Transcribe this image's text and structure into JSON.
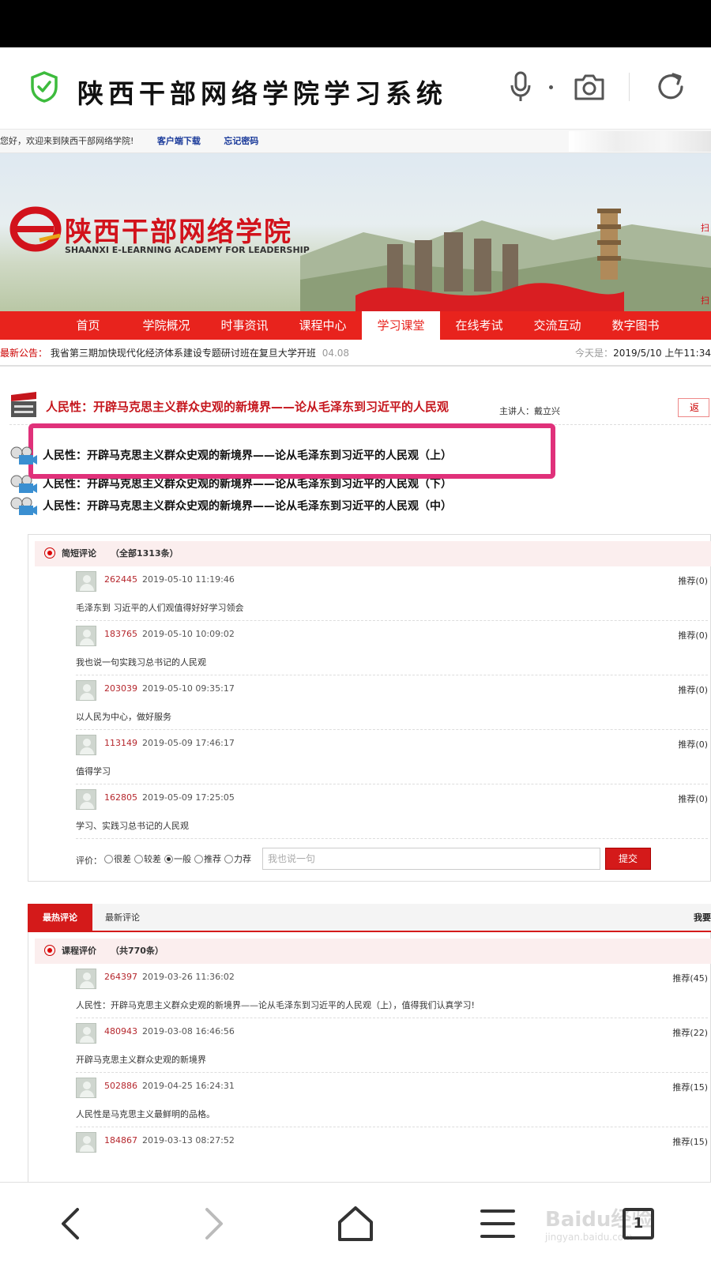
{
  "browser": {
    "title": "陕西干部网络学院学习系统",
    "icons": [
      "shield-check-icon",
      "microphone-icon",
      "camera-icon",
      "reload-icon"
    ]
  },
  "site": {
    "top_strip": {
      "greeting": "您好，欢迎来到陕西干部网络学院!",
      "links": [
        "客户端下载",
        "忘记密码"
      ]
    },
    "banner": {
      "name_cn": "陕西干部网络学院",
      "name_en": "SHAANXI E-LEARNING ACADEMY FOR LEADERSHIP",
      "side_text_1": "扫",
      "side_text_2": "扫"
    },
    "nav": [
      "首页",
      "学院概况",
      "时事资讯",
      "课程中心",
      "学习课堂",
      "在线考试",
      "交流互动",
      "数字图书"
    ],
    "nav_active": "学习课堂",
    "notice": {
      "label": "最新公告：",
      "text": "我省第三期加快现代化经济体系建设专题研讨班在复旦大学开班",
      "date": "04.08",
      "today_label": "今天是：",
      "today": "2019/5/10 上午11:34"
    }
  },
  "course": {
    "title": "人民性：开辟马克思主义群众史观的新境界——论从毛泽东到习近平的人民观",
    "lecturer_label": "主讲人：",
    "lecturer": "戴立兴",
    "back": "返",
    "lessons": [
      "人民性：开辟马克思主义群众史观的新境界——论从毛泽东到习近平的人民观（上）",
      "人民性：开辟马克思主义群众史观的新境界——论从毛泽东到习近平的人民观（下）",
      "人民性：开辟马克思主义群众史观的新境界——论从毛泽东到习近平的人民观（中）"
    ]
  },
  "short_comments": {
    "heading": "简短评论",
    "count": "（全部1313条）",
    "items": [
      {
        "uid": "262445",
        "time": "2019-05-10 11:19:46",
        "rec": "推荐(0)",
        "text": "毛泽东到 习近平的人们观值得好好学习领会"
      },
      {
        "uid": "183765",
        "time": "2019-05-10 10:09:02",
        "rec": "推荐(0)",
        "text": "我也说一句实践习总书记的人民观"
      },
      {
        "uid": "203039",
        "time": "2019-05-10 09:35:17",
        "rec": "推荐(0)",
        "text": "以人民为中心，做好服务"
      },
      {
        "uid": "113149",
        "time": "2019-05-09 17:46:17",
        "rec": "推荐(0)",
        "text": "值得学习"
      },
      {
        "uid": "162805",
        "time": "2019-05-09 17:25:05",
        "rec": "推荐(0)",
        "text": "学习、实践习总书记的人民观"
      }
    ],
    "rating": {
      "label": "评价：",
      "options": [
        "很差",
        "较差",
        "一般",
        "推荐",
        "力荐"
      ],
      "selected": "一般",
      "placeholder": "我也说一句",
      "submit": "提交"
    }
  },
  "tabs": {
    "hot": "最热评论",
    "latest": "最新评论",
    "right": "我要"
  },
  "course_reviews": {
    "heading": "课程评价",
    "count": "（共770条）",
    "items": [
      {
        "uid": "264397",
        "time": "2019-03-26 11:36:02",
        "rec": "推荐(45)",
        "text": "人民性：开辟马克思主义群众史观的新境界——论从毛泽东到习近平的人民观（上），值得我们认真学习!"
      },
      {
        "uid": "480943",
        "time": "2019-03-08 16:46:56",
        "rec": "推荐(22)",
        "text": "开辟马克思主义群众史观的新境界"
      },
      {
        "uid": "502886",
        "time": "2019-04-25 16:24:31",
        "rec": "推荐(15)",
        "text": "人民性是马克思主义最鲜明的品格。"
      },
      {
        "uid": "184867",
        "time": "2019-03-13 08:27:52",
        "rec": "推荐(15)",
        "text": ""
      }
    ]
  },
  "bottom_bar": {
    "icons": [
      "back-icon",
      "forward-icon",
      "home-icon",
      "menu-icon",
      "tabs-icon"
    ],
    "tab_count": "1",
    "watermark_1": "Baidu经验",
    "watermark_2": "jingyan.baidu.com"
  }
}
